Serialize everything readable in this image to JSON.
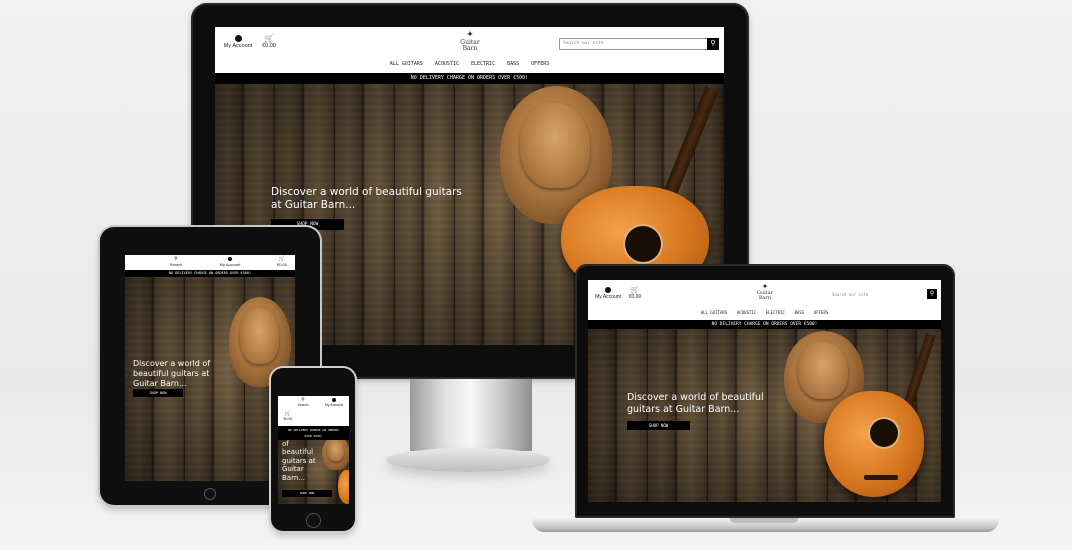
{
  "desktop": {
    "account_label": "My Account",
    "cart_label": "€0.00",
    "logo_line1": "Guitar",
    "logo_line2": "Barn",
    "search_placeholder": "Search our site",
    "nav": [
      "ALL GUITARS",
      "ACOUSTIC",
      "ELECTRIC",
      "BASS",
      "OFFERS"
    ],
    "banner": "NO DELIVERY CHARGE ON ORDERS OVER €500!",
    "hero_line1": "Discover a world of beautiful guitars",
    "hero_line2": "at Guitar Barn...",
    "shop_button": "SHOP NOW"
  },
  "laptop": {
    "account_label": "My Account",
    "cart_label": "€0.00",
    "logo_line1": "Guitar",
    "logo_line2": "Barn",
    "search_placeholder": "Search our site",
    "nav": [
      "ALL GUITARS",
      "ACOUSTIC",
      "ELECTRIC",
      "BASS",
      "OFFERS"
    ],
    "banner": "NO DELIVERY CHARGE ON ORDERS OVER €500!",
    "hero_line1": "Discover a world of beautiful",
    "hero_line2": "guitars at Guitar Barn...",
    "shop_button": "SHOP NOW"
  },
  "tablet": {
    "search_label": "Search",
    "account_label": "My Account",
    "cart_label": "€0.00",
    "banner": "NO DELIVERY CHARGE ON ORDERS OVER €500!",
    "hero_line1": "Discover a world of",
    "hero_line2": "beautiful guitars at",
    "hero_line3": "Guitar Barn...",
    "shop_button": "SHOP NOW"
  },
  "phone": {
    "search_label": "Search",
    "account_label": "My Account",
    "cart_label": "€0.00",
    "banner_line1": "NO DELIVERY CHARGE ON ORDERS",
    "banner_line2": "OVER €500!",
    "hero_line1": "of",
    "hero_line2": "beautiful",
    "hero_line3": "guitars at",
    "hero_line4": "Guitar",
    "hero_line5": "Barn...",
    "shop_button": "SHOP NOW"
  },
  "colors": {
    "header_bg": "#ffffff",
    "banner_bg": "#000000",
    "button_bg": "#000000",
    "hero_text": "#ffffff"
  }
}
